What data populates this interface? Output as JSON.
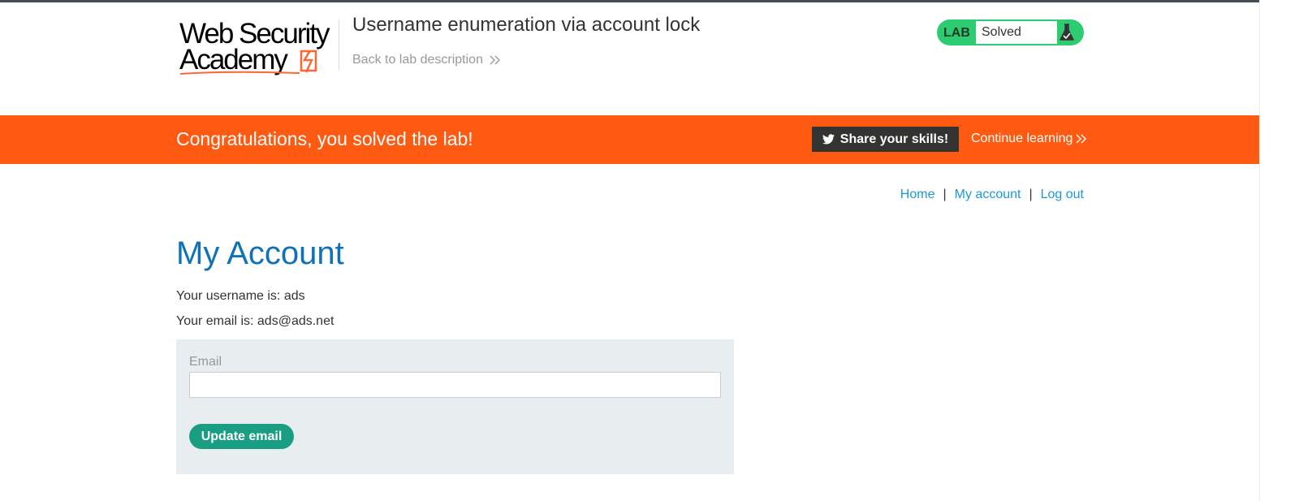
{
  "header": {
    "logo_line1": "Web Security",
    "logo_line2": "Academy",
    "lab_title": "Username enumeration via account lock",
    "back_link": "Back to lab description"
  },
  "lab_status": {
    "label": "LAB",
    "state": "Solved",
    "icon": "flask-icon",
    "color": "#2ecc71"
  },
  "banner": {
    "message": "Congratulations, you solved the lab!",
    "share_label": "Share your skills!",
    "share_icon": "twitter-icon",
    "continue_label": "Continue learning",
    "color": "#ff5a12"
  },
  "nav": {
    "items": [
      {
        "label": "Home"
      },
      {
        "label": "My account"
      },
      {
        "label": "Log out"
      }
    ],
    "separator": "|"
  },
  "main": {
    "title": "My Account",
    "username_line": "Your username is: ads",
    "email_line": "Your email is: ads@ads.net",
    "form": {
      "email_label": "Email",
      "email_value": "",
      "submit_label": "Update email"
    }
  }
}
